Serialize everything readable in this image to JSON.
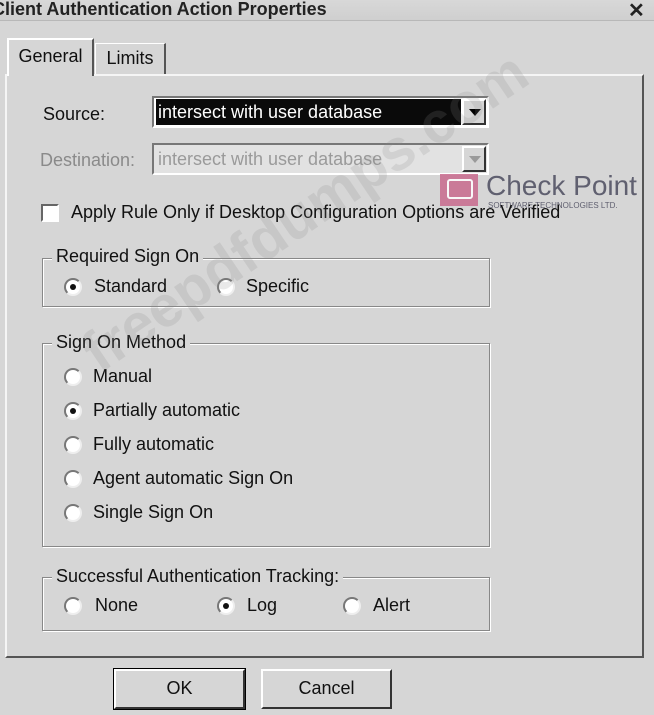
{
  "window": {
    "title": "Client Authentication Action Properties",
    "close_glyph": "✕"
  },
  "tabs": [
    {
      "label": "General",
      "active": true
    },
    {
      "label": "Limits",
      "active": false
    }
  ],
  "source": {
    "label": "Source:",
    "value": "intersect with user database"
  },
  "destination": {
    "label": "Destination:",
    "value": "intersect with user database",
    "disabled": true
  },
  "apply_rule": {
    "label": "Apply Rule Only if Desktop Configuration Options are Verified",
    "checked": false
  },
  "required_sign_on": {
    "legend": "Required Sign On",
    "options": [
      {
        "label": "Standard",
        "selected": true
      },
      {
        "label": "Specific",
        "selected": false
      }
    ]
  },
  "sign_on_method": {
    "legend": "Sign On Method",
    "options": [
      {
        "label": "Manual",
        "selected": false
      },
      {
        "label": "Partially automatic",
        "selected": true
      },
      {
        "label": "Fully automatic",
        "selected": false
      },
      {
        "label": "Agent automatic Sign On",
        "selected": false
      },
      {
        "label": "Single Sign On",
        "selected": false
      }
    ]
  },
  "tracking": {
    "legend": "Successful Authentication Tracking:",
    "options": [
      {
        "label": "None",
        "selected": false
      },
      {
        "label": "Log",
        "selected": true
      },
      {
        "label": "Alert",
        "selected": false
      }
    ]
  },
  "buttons": {
    "ok": "OK",
    "cancel": "Cancel"
  },
  "overlays": {
    "logo_name": "Check Point",
    "logo_sub": "SOFTWARE TECHNOLOGIES LTD.",
    "watermark": "freepdfdumps.com"
  },
  "colors": {
    "dialog_bg": "#d6d6d6",
    "selection": "#0a0a0a",
    "logo_pink": "#c96a8e"
  }
}
